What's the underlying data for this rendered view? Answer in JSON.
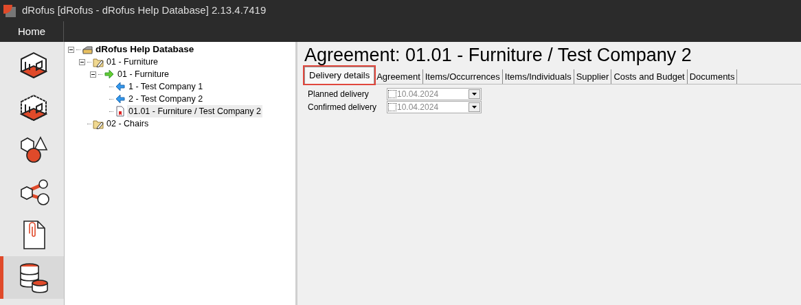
{
  "window": {
    "title": "dRofus [dRofus - dRofus Help Database] 2.13.4.7419"
  },
  "ribbon": {
    "tabs": [
      {
        "label": "Home",
        "selected": true
      }
    ]
  },
  "sidebar": {
    "items": [
      {
        "kind": "room",
        "selected": false
      },
      {
        "kind": "room-alt",
        "selected": false
      },
      {
        "kind": "items",
        "selected": false
      },
      {
        "kind": "systems",
        "selected": false
      },
      {
        "kind": "documents",
        "selected": false
      },
      {
        "kind": "database",
        "selected": true
      }
    ]
  },
  "tree": [
    {
      "label": "dRofus Help Database",
      "kind": "database",
      "expanded": true,
      "selected": false,
      "children": [
        {
          "label": "01 - Furniture",
          "kind": "folder",
          "expanded": true,
          "selected": false,
          "children": [
            {
              "label": "01 - Furniture",
              "kind": "arrow-right",
              "expanded": true,
              "selected": false,
              "children": [
                {
                  "label": "1 - Test Company 1",
                  "kind": "arrow-left",
                  "selected": false
                },
                {
                  "label": "2 - Test Company 2",
                  "kind": "arrow-left",
                  "selected": false
                },
                {
                  "label": "01.01 - Furniture / Test Company 2",
                  "kind": "document",
                  "selected": true
                }
              ]
            }
          ]
        },
        {
          "label": "02 - Chairs",
          "kind": "folder",
          "selected": false
        }
      ]
    }
  ],
  "heading": "Agreement: 01.01 - Furniture / Test Company 2",
  "tabs": [
    {
      "label": "Delivery details",
      "selected": true,
      "highlighted": true
    },
    {
      "label": "Agreement",
      "selected": false,
      "highlighted": false
    },
    {
      "label": "Items/Occurrences",
      "selected": false,
      "highlighted": false
    },
    {
      "label": "Items/Individuals",
      "selected": false,
      "highlighted": false
    },
    {
      "label": "Supplier",
      "selected": false,
      "highlighted": false
    },
    {
      "label": "Costs and Budget",
      "selected": false,
      "highlighted": false
    },
    {
      "label": "Documents",
      "selected": false,
      "highlighted": false
    }
  ],
  "fields": [
    {
      "label": "Planned delivery",
      "value": "10.04.2024",
      "checked": false
    },
    {
      "label": "Confirmed delivery",
      "value": "10.04.2024",
      "checked": false
    }
  ]
}
